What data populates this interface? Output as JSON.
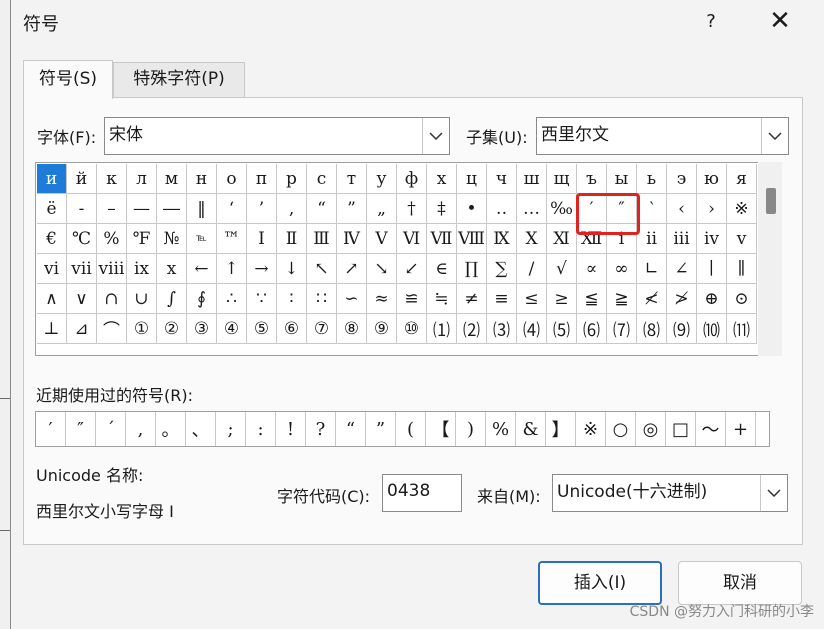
{
  "window": {
    "title": "符号",
    "help": "?",
    "close": "✕"
  },
  "tabs": [
    {
      "label": "符号(S)"
    },
    {
      "label": "特殊字符(P)"
    }
  ],
  "font": {
    "label": "字体(F):",
    "value": "宋体"
  },
  "subset": {
    "label": "子集(U):",
    "value": "西里尔文"
  },
  "symbol_grid": [
    [
      "и",
      "й",
      "к",
      "л",
      "м",
      "н",
      "о",
      "п",
      "р",
      "с",
      "т",
      "у",
      "ф",
      "х",
      "ц",
      "ч",
      "ш",
      "щ",
      "ъ",
      "ы",
      "ь",
      "э",
      "ю",
      "я"
    ],
    [
      "ё",
      "-",
      "–",
      "—",
      "―",
      "‖",
      "‘",
      "’",
      "‚",
      "“",
      "”",
      "„",
      "†",
      "‡",
      "•",
      "‥",
      "…",
      "‰",
      "′",
      "″",
      "‵",
      "‹",
      "›",
      "※"
    ],
    [
      "€",
      "℃",
      "%",
      "℉",
      "№",
      "℡",
      "™",
      "Ⅰ",
      "Ⅱ",
      "Ⅲ",
      "Ⅳ",
      "Ⅴ",
      "Ⅵ",
      "Ⅶ",
      "Ⅷ",
      "Ⅸ",
      "Ⅹ",
      "Ⅺ",
      "Ⅻ",
      "ⅰ",
      "ⅱ",
      "ⅲ",
      "ⅳ",
      "ⅴ"
    ],
    [
      "ⅵ",
      "ⅶ",
      "ⅷ",
      "ⅸ",
      "ⅹ",
      "←",
      "↑",
      "→",
      "↓",
      "↖",
      "↗",
      "↘",
      "↙",
      "∈",
      "∏",
      "∑",
      "∕",
      "√",
      "∝",
      "∞",
      "∟",
      "∠",
      "∣",
      "∥"
    ],
    [
      "∧",
      "∨",
      "∩",
      "∪",
      "∫",
      "∮",
      "∴",
      "∵",
      "∶",
      "∷",
      "∽",
      "≈",
      "≌",
      "≒",
      "≠",
      "≡",
      "≤",
      "≥",
      "≦",
      "≧",
      "≮",
      "≯",
      "⊕",
      "⊙"
    ],
    [
      "⊥",
      "⊿",
      "⌒",
      "①",
      "②",
      "③",
      "④",
      "⑤",
      "⑥",
      "⑦",
      "⑧",
      "⑨",
      "⑩",
      "⑴",
      "⑵",
      "⑶",
      "⑷",
      "⑸",
      "⑹",
      "⑺",
      "⑻",
      "⑼",
      "⑽",
      "⑾"
    ]
  ],
  "recent": {
    "label": "近期使用过的符号(R):",
    "symbols": [
      "′",
      "″",
      "´",
      ",",
      "。",
      "、",
      ";",
      ":",
      "!",
      "?",
      "“",
      "”",
      "(",
      "【",
      ")",
      "%",
      "&",
      "】",
      "※",
      "○",
      "◎",
      "□",
      "～",
      "+"
    ]
  },
  "unicode_name": {
    "label": "Unicode 名称:",
    "value": "西里尔文小写字母 I"
  },
  "char_code": {
    "label": "字符代码(C):",
    "value": "0438"
  },
  "from": {
    "label": "来自(M):",
    "value": "Unicode(十六进制)"
  },
  "buttons": {
    "insert": "插入(I)",
    "cancel": "取消"
  },
  "watermark": "CSDN @努力入门科研的小李",
  "colors": {
    "selection": "#1e7bd7",
    "highlight_box": "#e0231e",
    "primary_border": "#2b6fbf"
  }
}
